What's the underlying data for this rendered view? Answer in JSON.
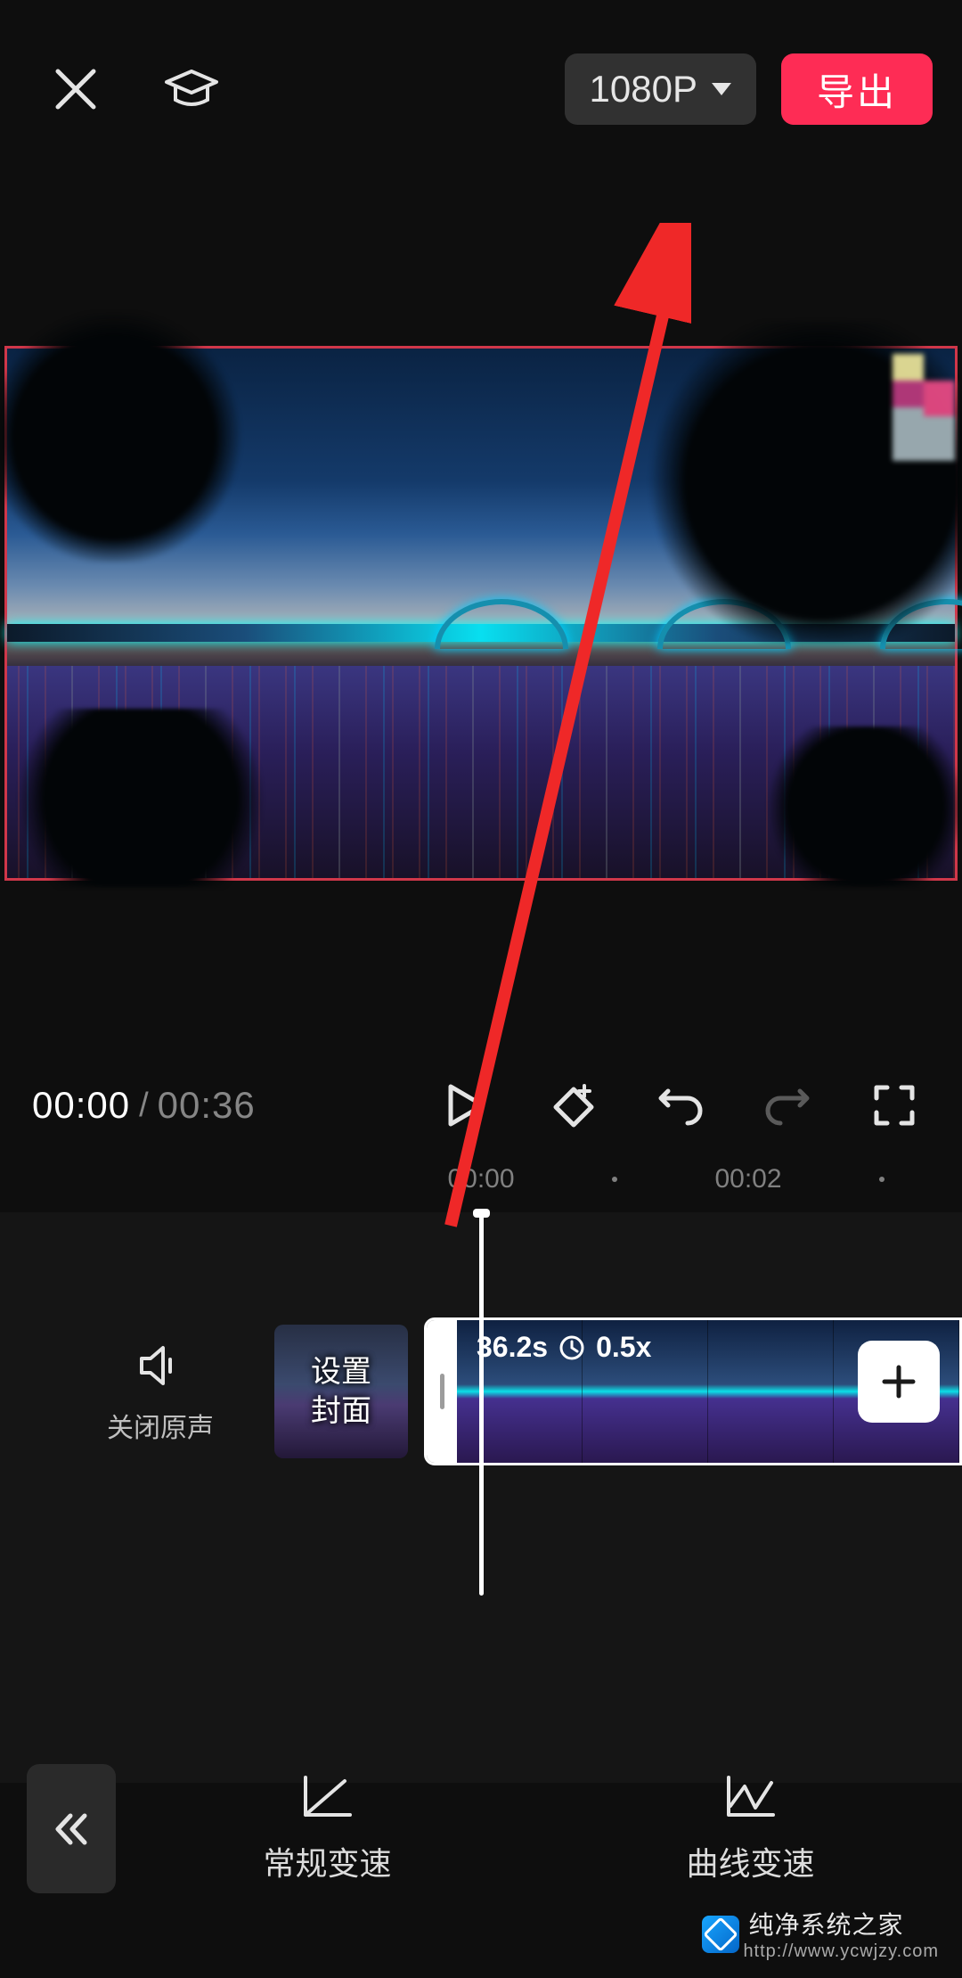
{
  "header": {
    "resolution": "1080P",
    "export_label": "导出"
  },
  "playback": {
    "current_time": "00:00",
    "total_time": "00:36"
  },
  "ruler": {
    "t0": "00:00",
    "t1": "00:02"
  },
  "timeline": {
    "mute_label": "关闭原声",
    "cover_line1": "设置",
    "cover_line2": "封面",
    "clip_duration": "36.2s",
    "clip_speed": "0.5x"
  },
  "bottombar": {
    "tool_regular": "常规变速",
    "tool_curve": "曲线变速"
  },
  "watermark": {
    "title": "纯净系统之家",
    "url": "http://www.ycwjzy.com"
  }
}
